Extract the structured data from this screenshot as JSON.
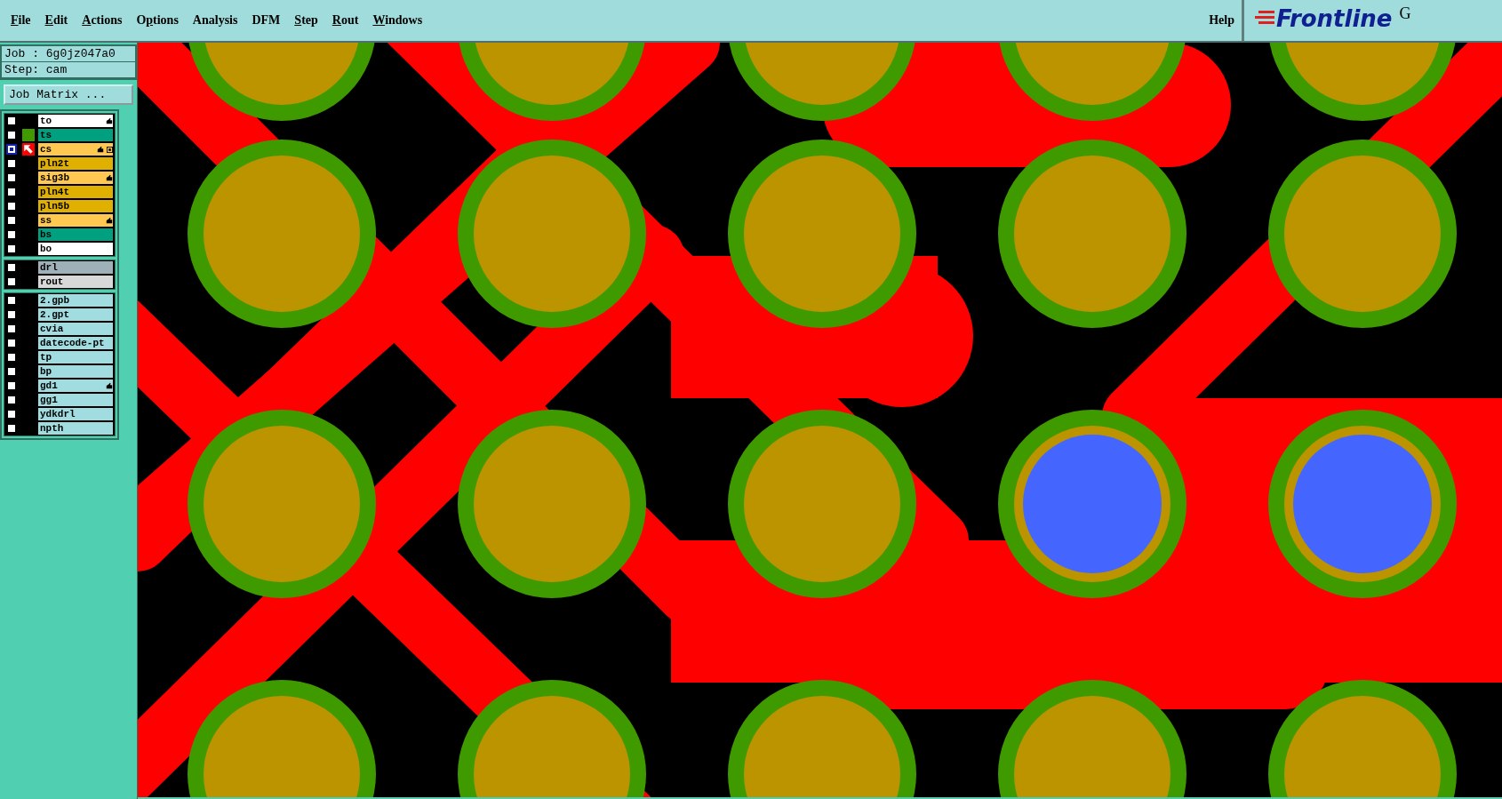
{
  "menu": [
    {
      "key": "F",
      "post": "ile"
    },
    {
      "key": "E",
      "post": "dit"
    },
    {
      "key": "A",
      "post": "ctions"
    },
    {
      "pre": "O",
      "key": "p",
      "post": "tions"
    },
    {
      "pre": "Analysis"
    },
    {
      "pre": "DFM"
    },
    {
      "key": "S",
      "post": "tep"
    },
    {
      "key": "R",
      "post": "out"
    },
    {
      "key": "W",
      "post": "indows"
    }
  ],
  "help": "Help",
  "logo": {
    "text": "Frontline",
    "superscript": "G"
  },
  "job": "Job : 6g0jz047a0",
  "step": "Step: cam",
  "job_matrix_button": "Job Matrix ...",
  "layer_groups": [
    [
      {
        "name": "to",
        "color": "#ffffff",
        "selected": false,
        "affected": true
      },
      {
        "name": "ts",
        "color": "#00a080",
        "selected": false,
        "swatch": {
          "color": "#409a00"
        }
      },
      {
        "name": "cs",
        "color": "#ffc850",
        "selected": true,
        "swatch": {
          "color": "#ff0000"
        },
        "affected": true,
        "attribute": true
      },
      {
        "name": "pln2t",
        "color": "#e0b000",
        "selected": false
      },
      {
        "name": "sig3b",
        "color": "#ffc850",
        "selected": false,
        "affected": true
      },
      {
        "name": "pln4t",
        "color": "#e0b000",
        "selected": false
      },
      {
        "name": "pln5b",
        "color": "#e0b000",
        "selected": false
      },
      {
        "name": "ss",
        "color": "#ffc850",
        "selected": false,
        "affected": true
      },
      {
        "name": "bs",
        "color": "#00a080",
        "selected": false
      },
      {
        "name": "bo",
        "color": "#ffffff",
        "selected": false
      }
    ],
    [
      {
        "name": "drl",
        "color": "#a0b0b8",
        "selected": false
      },
      {
        "name": "rout",
        "color": "#d8d8d8",
        "selected": false
      }
    ],
    [
      {
        "name": "2.gpb",
        "color": "#a0dce0",
        "selected": false
      },
      {
        "name": "2.gpt",
        "color": "#a0dce0",
        "selected": false
      },
      {
        "name": "cvia",
        "color": "#a0dce0",
        "selected": false
      },
      {
        "name": "datecode-pt",
        "color": "#a0dce0",
        "selected": false
      },
      {
        "name": "tp",
        "color": "#a0dce0",
        "selected": false
      },
      {
        "name": "bp",
        "color": "#a0dce0",
        "selected": false
      },
      {
        "name": "gd1",
        "color": "#a0dce0",
        "selected": false,
        "affected": true
      },
      {
        "name": "gg1",
        "color": "#a0dce0",
        "selected": false
      },
      {
        "name": "ydkdrl",
        "color": "#a0dce0",
        "selected": false
      },
      {
        "name": "npth",
        "color": "#a0dce0",
        "selected": false
      }
    ]
  ]
}
